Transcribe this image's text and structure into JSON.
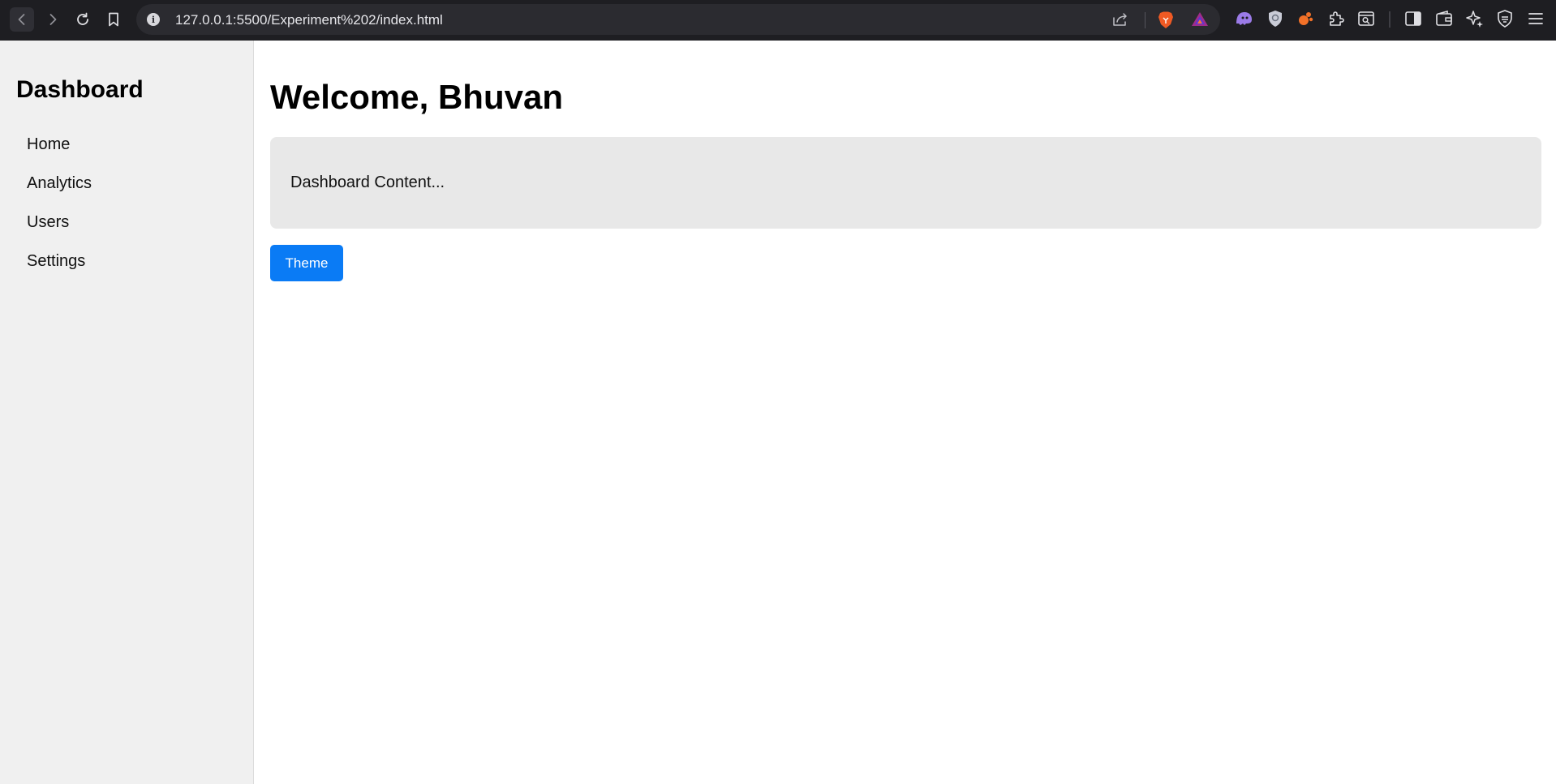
{
  "browser": {
    "url": "127.0.0.1:5500/Experiment%202/index.html",
    "info_icon_glyph": "i",
    "icons": [
      "back-icon",
      "forward-icon",
      "reload-icon",
      "bookmark-icon",
      "site-info-icon",
      "share-icon",
      "brave-shields-icon",
      "brave-rewards-icon",
      "ghost-extension-icon",
      "privacy-extension-icon",
      "orange-extension-icon",
      "extensions-icon",
      "search-panel-icon",
      "sidebar-icon",
      "wallet-icon",
      "leo-ai-icon",
      "vpn-icon",
      "menu-icon"
    ]
  },
  "sidebar": {
    "title": "Dashboard",
    "items": [
      {
        "label": "Home"
      },
      {
        "label": "Analytics"
      },
      {
        "label": "Users"
      },
      {
        "label": "Settings"
      }
    ]
  },
  "main": {
    "welcome": "Welcome, Bhuvan",
    "content_text": "Dashboard Content...",
    "theme_button_label": "Theme"
  },
  "colors": {
    "sidebar_bg": "#f0f0f0",
    "card_bg": "#e8e8e8",
    "button_bg": "#0a7bf5",
    "chrome_bg": "#1e1e22"
  }
}
